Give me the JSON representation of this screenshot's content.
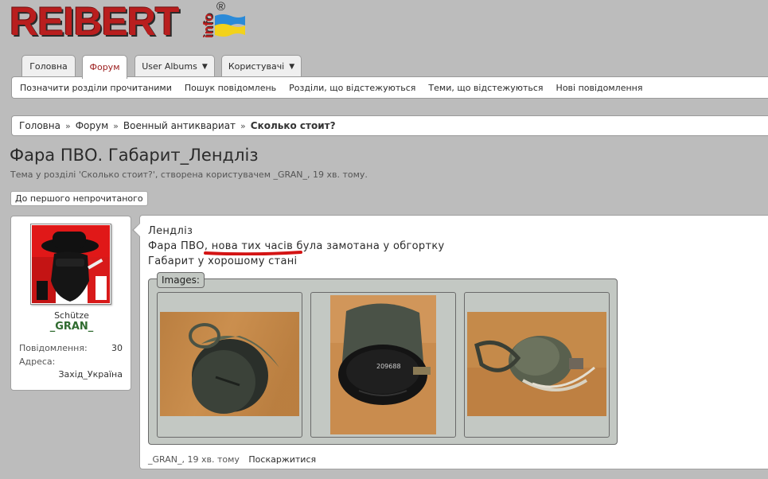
{
  "site": {
    "logo_text": "REIBERT",
    "logo_suffix": "info",
    "logo_reg": "®"
  },
  "tabs": [
    {
      "label": "Головна",
      "active": false,
      "dropdown": false
    },
    {
      "label": "Форум",
      "active": true,
      "dropdown": false
    },
    {
      "label": "User Albums",
      "active": false,
      "dropdown": true
    },
    {
      "label": "Користувачі",
      "active": false,
      "dropdown": true
    }
  ],
  "subnav": [
    "Позначити розділи прочитаними",
    "Пошук повідомлень",
    "Розділи, що відстежуються",
    "Теми, що відстежуються",
    "Нові повідомлення"
  ],
  "breadcrumb": {
    "items": [
      "Головна",
      "Форум",
      "Военный антиквариат"
    ],
    "current": "Сколько стоит?",
    "separator": "»"
  },
  "thread": {
    "title": "Фара ПВО. Габарит_Лендліз",
    "description": "Тема у розділі 'Сколько стоит?', створена користувачем _GRAN_, 19 хв. тому.",
    "unread_button": "До першого непрочитаного"
  },
  "user": {
    "title": "Schütze",
    "name": "_GRAN_",
    "stats": [
      {
        "label": "Повідомлення:",
        "value": "30"
      },
      {
        "label": "Адреса:",
        "value": "Захід_Україна"
      }
    ]
  },
  "post": {
    "lines": [
      "Лендліз",
      "Фара ПВО, нова тих часів була замотана у обгортку",
      "Габарит у хорошому стані"
    ],
    "images_label": "Images:",
    "footer_author": "_GRAN_",
    "footer_time": ", 19 хв. тому",
    "report_label": "Поскаржитися"
  },
  "colors": {
    "background": "#bcbcbc",
    "brand_red": "#b91e1e",
    "active_tab": "#9b1c1c",
    "username_green": "#2f6b2f",
    "images_box": "#c3c8c3",
    "mark_red": "#d41414"
  },
  "icons": {
    "chevron": "chevron-down-icon",
    "flag": "ukraine-flag-icon"
  }
}
